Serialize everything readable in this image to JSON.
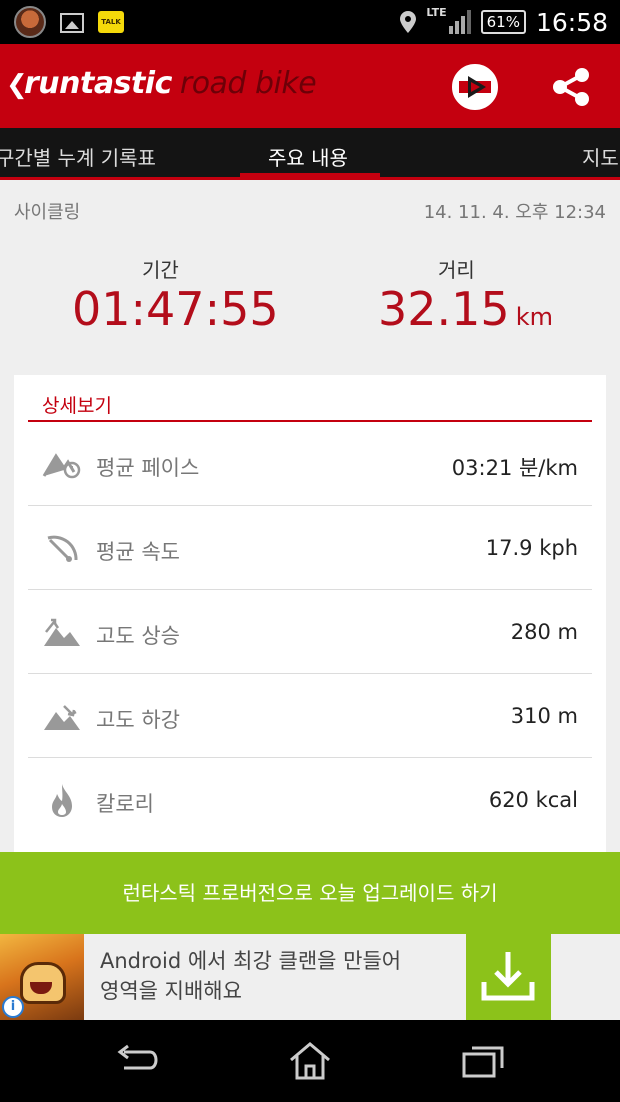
{
  "status_bar": {
    "network": "LTE",
    "battery": "61%",
    "time": "16:58",
    "icons": [
      "headphones-app-icon",
      "gallery-icon",
      "kakaotalk-icon",
      "location-icon",
      "signal-icon",
      "battery-icon"
    ],
    "talk_label": "TALK"
  },
  "app_bar": {
    "brand_main": "runtastic",
    "brand_sub": "road bike",
    "back_icon": "chevron-left-icon",
    "actions": [
      "pro-upgrade-icon",
      "share-icon"
    ]
  },
  "tabs": [
    {
      "label": "구간별 누계 기록표",
      "active": false
    },
    {
      "label": "주요 내용",
      "active": true
    },
    {
      "label": "지도",
      "active": false
    }
  ],
  "activity": {
    "type": "사이클링",
    "date": "14. 11. 4. 오후 12:34"
  },
  "summary": {
    "duration_label": "기간",
    "duration_value": "01:47:55",
    "distance_label": "거리",
    "distance_value": "32.15",
    "distance_unit": "km"
  },
  "details": {
    "title": "상세보기",
    "rows": [
      {
        "icon": "pace-icon",
        "label": "평균 페이스",
        "value": "03:21 분/km"
      },
      {
        "icon": "speedometer-icon",
        "label": "평균 속도",
        "value": "17.9  kph"
      },
      {
        "icon": "elevation-up-icon",
        "label": "고도 상승",
        "value": "280 m"
      },
      {
        "icon": "elevation-down-icon",
        "label": "고도 하강",
        "value": "310 m"
      },
      {
        "icon": "flame-icon",
        "label": "칼로리",
        "value": "620 kcal"
      }
    ]
  },
  "upgrade_banner": {
    "label": "런타스틱 프로버전으로 오늘 업그레이드 하기"
  },
  "ad": {
    "line1": "Android 에서 최강 클랜을 만들어",
    "line2": "영역을 지배해요",
    "info_label": "i",
    "icons": [
      "game-ad-image",
      "ad-info-icon",
      "download-icon"
    ]
  },
  "nav_bar": {
    "icons": [
      "back-icon",
      "home-icon",
      "recent-apps-icon"
    ]
  },
  "colors": {
    "accent": "#c4000f",
    "value_red": "#b30d1b",
    "green": "#8cc21a",
    "tab_bg": "#141414"
  }
}
